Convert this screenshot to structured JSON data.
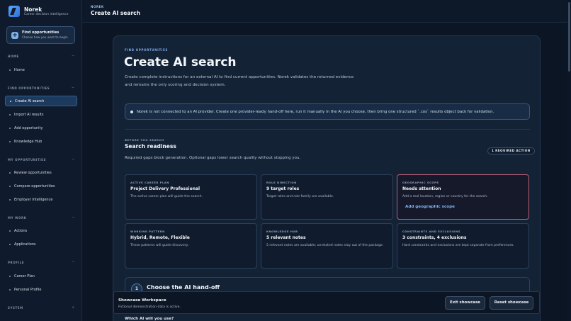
{
  "brand": {
    "name": "Norek",
    "tagline": "Career decision intelligence"
  },
  "find_card": {
    "title": "Find opportunities",
    "subtitle": "Choose how you want to begin",
    "icon": "plus-icon"
  },
  "sidebar": {
    "sections": [
      {
        "label": "HOME",
        "toggle": "−"
      },
      {
        "label": "FIND OPPORTUNITIES",
        "toggle": "−"
      },
      {
        "label": "MY OPPORTUNITIES",
        "toggle": "−"
      },
      {
        "label": "MY WORK",
        "toggle": "−"
      },
      {
        "label": "PROFILE",
        "toggle": "−"
      },
      {
        "label": "SYSTEM",
        "toggle": "+"
      }
    ],
    "items": [
      {
        "label": "Home"
      },
      {
        "label": "Create AI search",
        "active": true
      },
      {
        "label": "Import AI results"
      },
      {
        "label": "Add opportunity"
      },
      {
        "label": "Knowledge Hub"
      },
      {
        "label": "Review opportunities"
      },
      {
        "label": "Compare opportunities"
      },
      {
        "label": "Employer Intelligence"
      },
      {
        "label": "Actions"
      },
      {
        "label": "Applications"
      },
      {
        "label": "Career Plan"
      },
      {
        "label": "Personal Profile"
      }
    ]
  },
  "topbar": {
    "breadcrumb": "NOREK",
    "title": "Create AI search"
  },
  "main": {
    "eyebrow": "FIND OPPORTUNITIES",
    "title": "Create AI search",
    "description": "Create complete instructions for an external AI to find current opportunities. Norek validates the returned evidence and remains the only scoring and decision system.",
    "notice": "Norek is not connected to an AI provider. Create one provider-ready hand-off here, run it manually in the AI you choose, then bring one structured `.cos` results object back for validation.",
    "readiness": {
      "eyebrow": "BEFORE YOU SEARCH",
      "title": "Search readiness",
      "description": "Required gaps block generation. Optional gaps lower search quality without stopping you.",
      "badge": "1 REQUIRED ACTION",
      "cards": [
        {
          "eyebrow": "ACTIVE CAREER PLAN",
          "title": "Project Delivery Professional",
          "desc": "The active career plan will guide the search."
        },
        {
          "eyebrow": "ROLE DIRECTION",
          "title": "9 target roles",
          "desc": "Target roles and role family are available."
        },
        {
          "eyebrow": "GEOGRAPHIC SCOPE",
          "title": "Needs attention",
          "desc": "Add a real location, region or country for the search.",
          "link": "Add geographic scope"
        },
        {
          "eyebrow": "WORKING PATTERN",
          "title": "Hybrid, Remote, Flexible",
          "desc": "These patterns will guide discovery."
        },
        {
          "eyebrow": "KNOWLEDGE HUB",
          "title": "5 relevant notes",
          "desc": "5 relevant notes are available; unrelated notes stay out of the package."
        },
        {
          "eyebrow": "CONSTRAINTS AND EXCLUSIONS",
          "title": "3 constraints, 4 exclusions",
          "desc": "Hard constraints and exclusions are kept separate from preferences."
        }
      ]
    },
    "step": {
      "number": "1",
      "title": "Choose the AI hand-off",
      "question": "Which AI will you use?"
    }
  },
  "showcase": {
    "title": "Showcase Workspace",
    "subtitle": "Fictional demonstration data is active.",
    "exit_label": "Exit showcase",
    "reset_label": "Reset showcase"
  },
  "colors": {
    "accent": "#7fb3ee",
    "warning_border": "#b85f78",
    "background": "#0b1524"
  }
}
